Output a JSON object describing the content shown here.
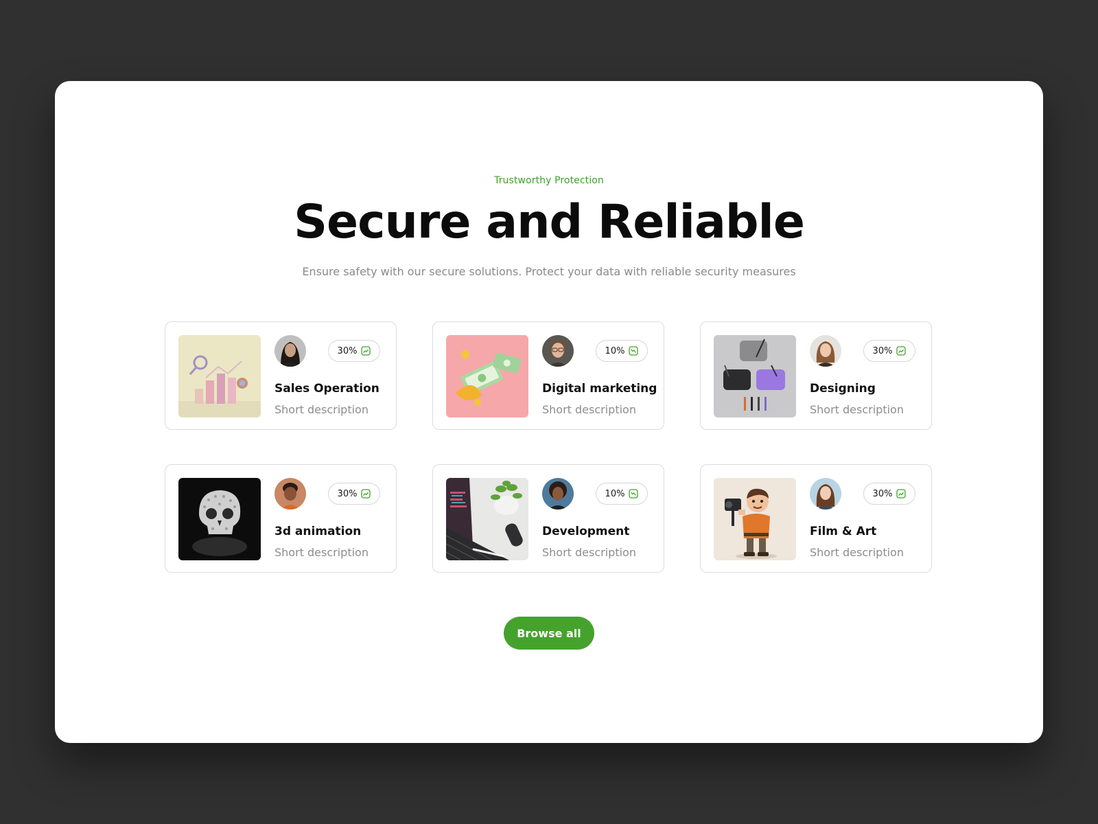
{
  "header": {
    "eyebrow": "Trustworthy Protection",
    "title": "Secure and Reliable",
    "subtitle": "Ensure safety with our secure solutions. Protect your data with reliable security measures"
  },
  "cards": [
    {
      "title": "Sales Operation",
      "description": "Short description",
      "badge": "30%",
      "trend": "up",
      "image": "bar-chart-illustration",
      "avatar": "woman-avatar"
    },
    {
      "title": "Digital marketing",
      "description": "Short description",
      "badge": "10%",
      "trend": "down",
      "image": "money-illustration",
      "avatar": "man-glasses-avatar"
    },
    {
      "title": "Designing",
      "description": "Short description",
      "badge": "30%",
      "trend": "up",
      "image": "drawing-tablets-illustration",
      "avatar": "woman-avatar"
    },
    {
      "title": "3d animation",
      "description": "Short description",
      "badge": "30%",
      "trend": "up",
      "image": "skull-render",
      "avatar": "woman-avatar"
    },
    {
      "title": "Development",
      "description": "Short description",
      "badge": "10%",
      "trend": "down",
      "image": "laptop-plant-photo",
      "avatar": "woman-avatar"
    },
    {
      "title": "Film & Art",
      "description": "Short description",
      "badge": "30%",
      "trend": "up",
      "image": "cartoon-filmmaker",
      "avatar": "woman-avatar"
    }
  ],
  "actions": {
    "browse_label": "Browse all"
  },
  "colors": {
    "accent": "#45a22d",
    "background": "#303030",
    "panel": "#ffffff"
  }
}
